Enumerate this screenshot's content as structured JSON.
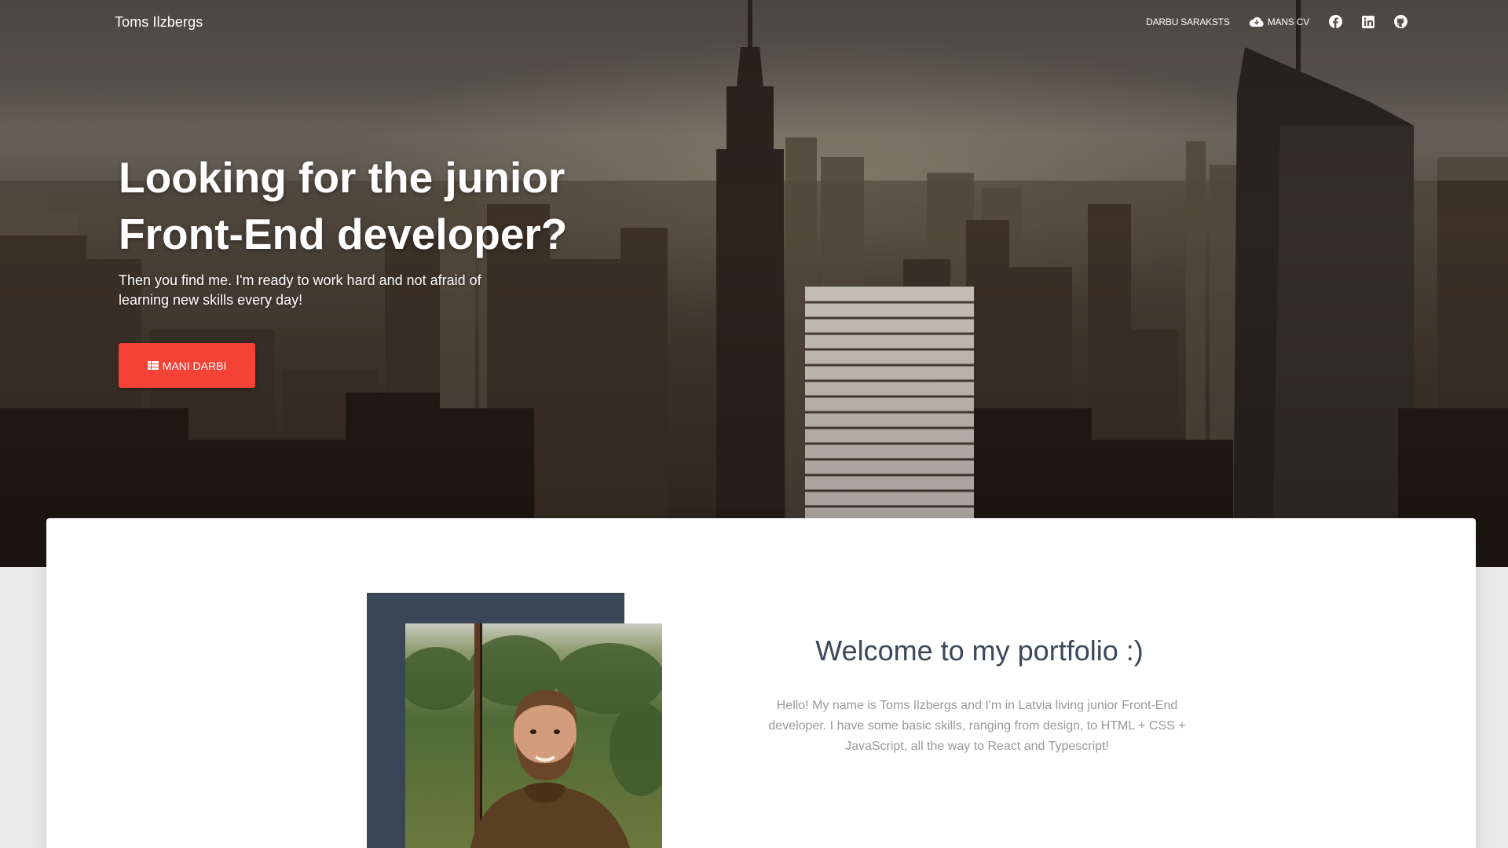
{
  "header": {
    "brand": "Toms Ilzbergs",
    "nav": {
      "projects_label": "DARBU SARAKSTS",
      "cv_label": "MANS CV",
      "icons": [
        "facebook-icon",
        "linkedin-icon",
        "github-icon"
      ]
    }
  },
  "hero": {
    "title_line1": "Looking for the junior",
    "title_line2": "Front-End developer?",
    "subtitle": "Then you find me. I'm ready to work hard and not afraid of learning new skills every day!",
    "cta_label": "MANI DARBI",
    "cta_color": "#f44336"
  },
  "about": {
    "heading": "Welcome to my portfolio :)",
    "text": "Hello! My name is Toms Ilzbergs and I'm in Latvia living junior Front-End developer. I have some basic skills, ranging from design, to HTML + CSS + JavaScript, all the way to React and Typescript!",
    "frame_color": "#3a4556"
  }
}
